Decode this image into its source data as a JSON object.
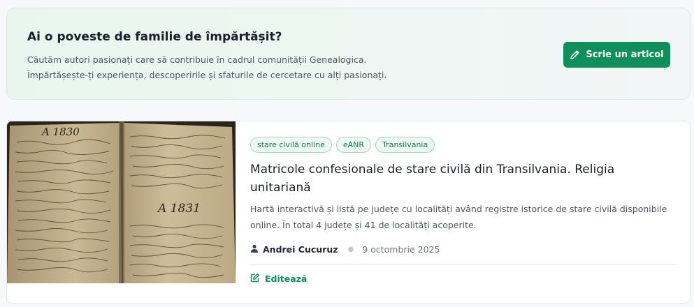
{
  "promo": {
    "title": "Ai o poveste de familie de împărtășit?",
    "description_line1": "Căutăm autori pasionați care să contribuie în cadrul comunității Genealogica.",
    "description_line2": "Împărtășește-ți experiența, descoperirile și sfaturile de cercetare cu alți pasionați.",
    "button_label": "Scrie un articol",
    "button_icon": "pencil-icon",
    "accent_color": "#0e8f5b"
  },
  "article": {
    "tags": [
      "stare civilă online",
      "eANR",
      "Transilvania"
    ],
    "title": "Matricole confesionale de stare civilă din Transilvania. Religia unitariană",
    "excerpt": "Hartă interactivă și listă pe județe cu localități având registre istorice de stare civilă disponibile online. În total 4 județe și 41 de localități acoperite.",
    "author": "Andrei Cucuruz",
    "author_icon": "person-icon",
    "date": "9 octombrie 2025",
    "edit_label": "Editează",
    "edit_icon": "edit-icon",
    "image_text_top": "A 1830",
    "image_text_mid": "A 1831"
  }
}
